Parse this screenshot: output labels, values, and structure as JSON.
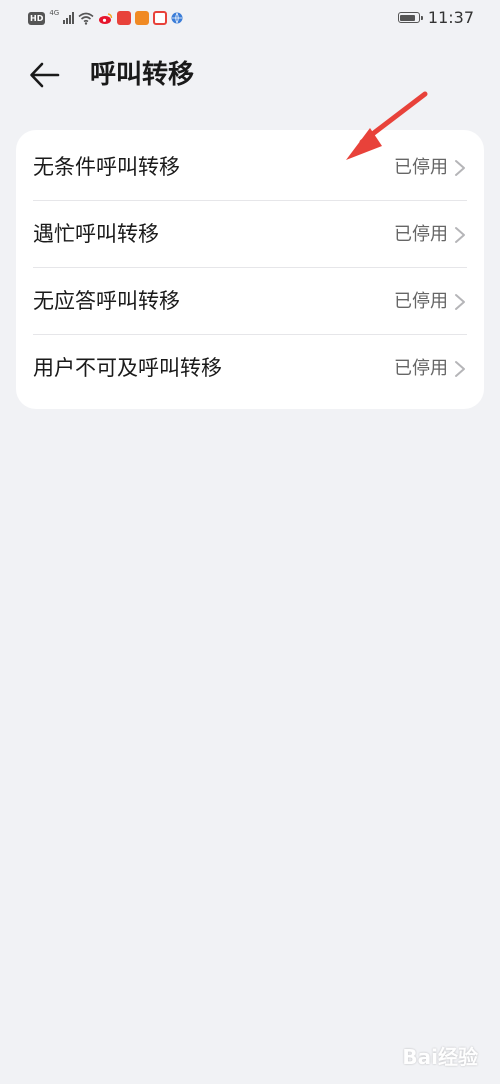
{
  "status_bar": {
    "hd": "HD",
    "network": "4G",
    "time": "11:37"
  },
  "header": {
    "title": "呼叫转移",
    "back_icon": "arrow-left-icon"
  },
  "items": [
    {
      "label": "无条件呼叫转移",
      "status": "已停用"
    },
    {
      "label": "遇忙呼叫转移",
      "status": "已停用"
    },
    {
      "label": "无应答呼叫转移",
      "status": "已停用"
    },
    {
      "label": "用户不可及呼叫转移",
      "status": "已停用"
    }
  ],
  "colors": {
    "background": "#f1f2f5",
    "card": "#ffffff",
    "annotation_arrow": "#e8423a"
  },
  "watermark": "Bai经验"
}
